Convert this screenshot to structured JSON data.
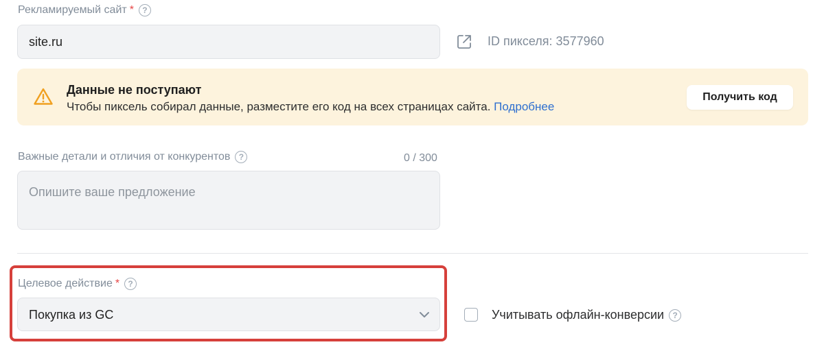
{
  "site": {
    "label": "Рекламируемый сайт",
    "required_mark": "*",
    "help": "?",
    "value": "site.ru",
    "pixel_id": "ID пикселя: 3577960",
    "external_link_icon": "external-link-icon"
  },
  "alert": {
    "icon": "warning-icon",
    "title": "Данные не поступают",
    "text": "Чтобы пиксель собирал данные, разместите его код на всех страницах сайта.",
    "link": "Подробнее",
    "button": "Получить код"
  },
  "details": {
    "label": "Важные детали и отличия от конкурентов",
    "help": "?",
    "counter": "0 / 300",
    "placeholder": "Опишите ваше предложение"
  },
  "target_action": {
    "label": "Целевое действие",
    "required_mark": "*",
    "help": "?",
    "value": "Покупка из GC"
  },
  "offline": {
    "label": "Учитывать офлайн-конверсии",
    "help": "?",
    "checked": false
  },
  "colors": {
    "highlight": "#d6403b",
    "alert_bg": "#fdf3dd",
    "link": "#2e6fcf",
    "warning": "#f0a020"
  }
}
